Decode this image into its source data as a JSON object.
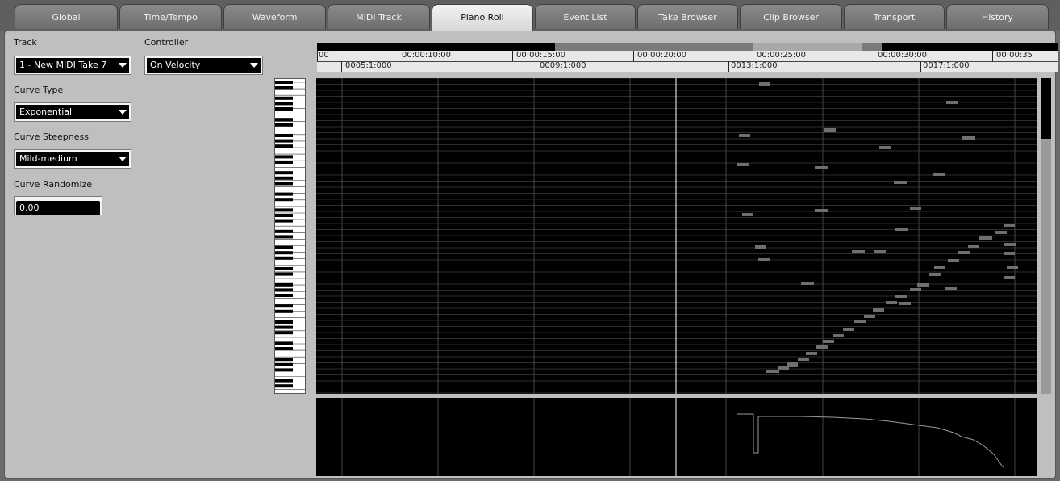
{
  "tabs": [
    {
      "label": "Global",
      "active": false
    },
    {
      "label": "Time/Tempo",
      "active": false
    },
    {
      "label": "Waveform",
      "active": false
    },
    {
      "label": "MIDI Track",
      "active": false
    },
    {
      "label": "Piano Roll",
      "active": true
    },
    {
      "label": "Event List",
      "active": false
    },
    {
      "label": "Take Browser",
      "active": false
    },
    {
      "label": "Clip Browser",
      "active": false
    },
    {
      "label": "Transport",
      "active": false
    },
    {
      "label": "History",
      "active": false
    }
  ],
  "sidebar": {
    "track_label": "Track",
    "track_value": "1 - New MIDI Take 7",
    "controller_label": "Controller",
    "controller_value": "On Velocity",
    "curve_type_label": "Curve Type",
    "curve_type_value": "Exponential",
    "curve_steepness_label": "Curve Steepness",
    "curve_steepness_value": "Mild-medium",
    "curve_randomize_label": "Curve Randomize",
    "curve_randomize_value": "0.00"
  },
  "ruler": {
    "time_labels": [
      "00",
      "00:00:10:00",
      "00:00:15:00",
      "00:00:20:00",
      "00:00:25:00",
      "00:00:30:00",
      "00:00:35"
    ],
    "bar_labels": [
      "0005:1:000",
      "0009:1:000",
      "0013:1:000",
      "0017:1:000"
    ]
  },
  "colors": {
    "note": "#6f6f6f",
    "velocity_line": "#9a9a9a",
    "playhead": "#ffffff",
    "active_tab": "#e8e8e8"
  }
}
